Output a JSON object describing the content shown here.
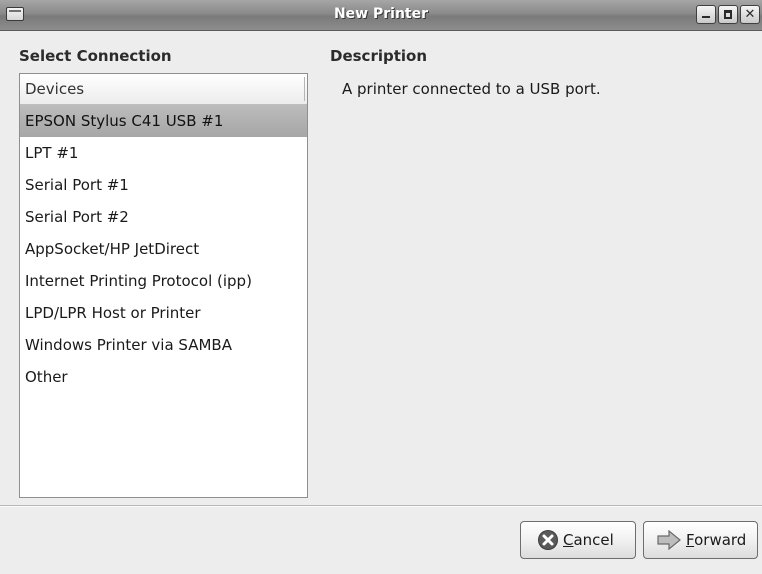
{
  "window": {
    "title": "New Printer"
  },
  "select_connection": {
    "title": "Select Connection",
    "header": "Devices",
    "items": [
      {
        "label": "EPSON Stylus C41 USB #1",
        "selected": true
      },
      {
        "label": "LPT #1",
        "selected": false
      },
      {
        "label": "Serial Port #1",
        "selected": false
      },
      {
        "label": "Serial Port #2",
        "selected": false
      },
      {
        "label": "AppSocket/HP JetDirect",
        "selected": false
      },
      {
        "label": "Internet Printing Protocol (ipp)",
        "selected": false
      },
      {
        "label": "LPD/LPR Host or Printer",
        "selected": false
      },
      {
        "label": "Windows Printer via SAMBA",
        "selected": false
      },
      {
        "label": "Other",
        "selected": false
      }
    ]
  },
  "description": {
    "title": "Description",
    "text": "A printer connected to a USB port."
  },
  "buttons": {
    "cancel": {
      "mnemonic": "C",
      "rest": "ancel",
      "icon": "cancel-icon"
    },
    "forward": {
      "mnemonic": "F",
      "rest": "orward",
      "icon": "forward-arrow-icon"
    }
  },
  "colors": {
    "selection": "#b0b0b0",
    "background": "#ededed"
  }
}
